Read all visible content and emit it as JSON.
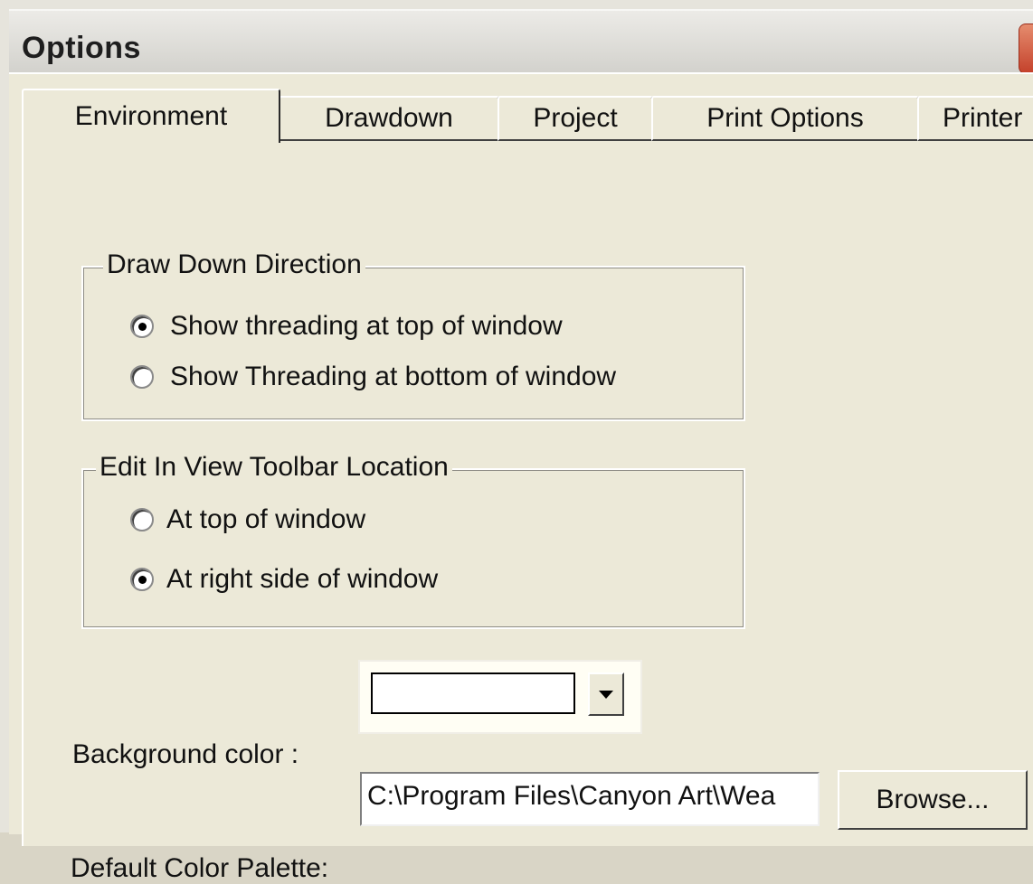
{
  "dialog": {
    "title": "Options"
  },
  "tabs": [
    "Environment",
    "Drawdown",
    "Project",
    "Print Options",
    "Printer"
  ],
  "active_tab": "Environment",
  "draw_down_direction": {
    "legend": "Draw Down Direction",
    "options": [
      "Show threading at top of window",
      "Show Threading at bottom of window"
    ],
    "selected_index": 0
  },
  "toolbar_location": {
    "legend": "Edit In View Toolbar Location",
    "options": [
      "At top of window",
      "At right side of window"
    ],
    "selected_index": 1
  },
  "background_color": {
    "label": "Background color :",
    "value": "#ffffff"
  },
  "default_palette": {
    "label": "Default Color Palette:",
    "value": "C:\\Program Files\\Canyon Art\\Wea",
    "browse_label": "Browse..."
  },
  "colors": {
    "face": "#ece9d8",
    "close": "#c4412b"
  },
  "icons": {
    "close": "close-icon",
    "dropdown": "chevron-down-icon"
  }
}
